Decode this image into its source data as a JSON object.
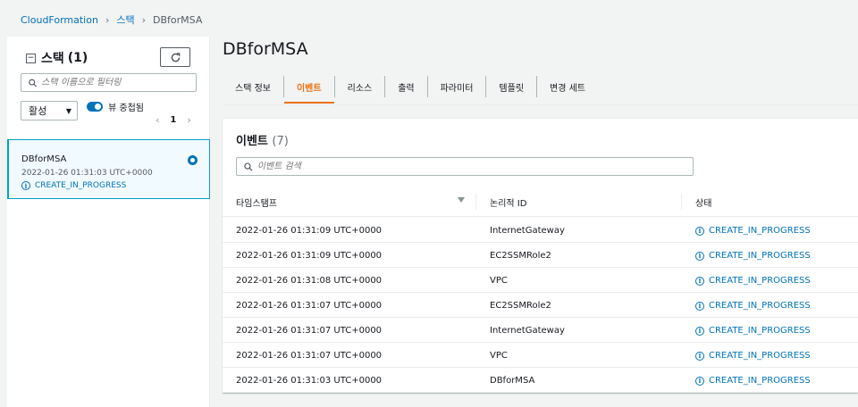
{
  "breadcrumb": {
    "root": "CloudFormation",
    "stacks": "스택",
    "current": "DBforMSA"
  },
  "left_panel": {
    "title": "스택",
    "count": "(1)",
    "search_placeholder": "스택 이름으로 필터링",
    "filter_value": "활성",
    "toggle_label": "뷰 중첩됨",
    "page": "1",
    "stack": {
      "name": "DBforMSA",
      "time": "2022-01-26 01:31:03 UTC+0000",
      "status": "CREATE_IN_PROGRESS"
    }
  },
  "main": {
    "title": "DBforMSA",
    "tabs": [
      "스택 정보",
      "이벤트",
      "리소스",
      "출력",
      "파라미터",
      "템플릿",
      "변경 세트"
    ],
    "active_tab": 1,
    "events": {
      "title": "이벤트",
      "count": "(7)",
      "search_placeholder": "이벤트 검색",
      "columns": [
        "타임스탬프",
        "논리적 ID",
        "상태"
      ],
      "rows": [
        {
          "timestamp": "2022-01-26 01:31:09 UTC+0000",
          "logical_id": "InternetGateway",
          "status": "CREATE_IN_PROGRESS"
        },
        {
          "timestamp": "2022-01-26 01:31:09 UTC+0000",
          "logical_id": "EC2SSMRole2",
          "status": "CREATE_IN_PROGRESS"
        },
        {
          "timestamp": "2022-01-26 01:31:08 UTC+0000",
          "logical_id": "VPC",
          "status": "CREATE_IN_PROGRESS"
        },
        {
          "timestamp": "2022-01-26 01:31:07 UTC+0000",
          "logical_id": "EC2SSMRole2",
          "status": "CREATE_IN_PROGRESS"
        },
        {
          "timestamp": "2022-01-26 01:31:07 UTC+0000",
          "logical_id": "InternetGateway",
          "status": "CREATE_IN_PROGRESS"
        },
        {
          "timestamp": "2022-01-26 01:31:07 UTC+0000",
          "logical_id": "VPC",
          "status": "CREATE_IN_PROGRESS"
        },
        {
          "timestamp": "2022-01-26 01:31:03 UTC+0000",
          "logical_id": "DBforMSA",
          "status": "CREATE_IN_PROGRESS"
        }
      ]
    }
  },
  "colors": {
    "link": "#0073bb",
    "accent": "#ec7211",
    "selected_bg": "#f1faff"
  }
}
